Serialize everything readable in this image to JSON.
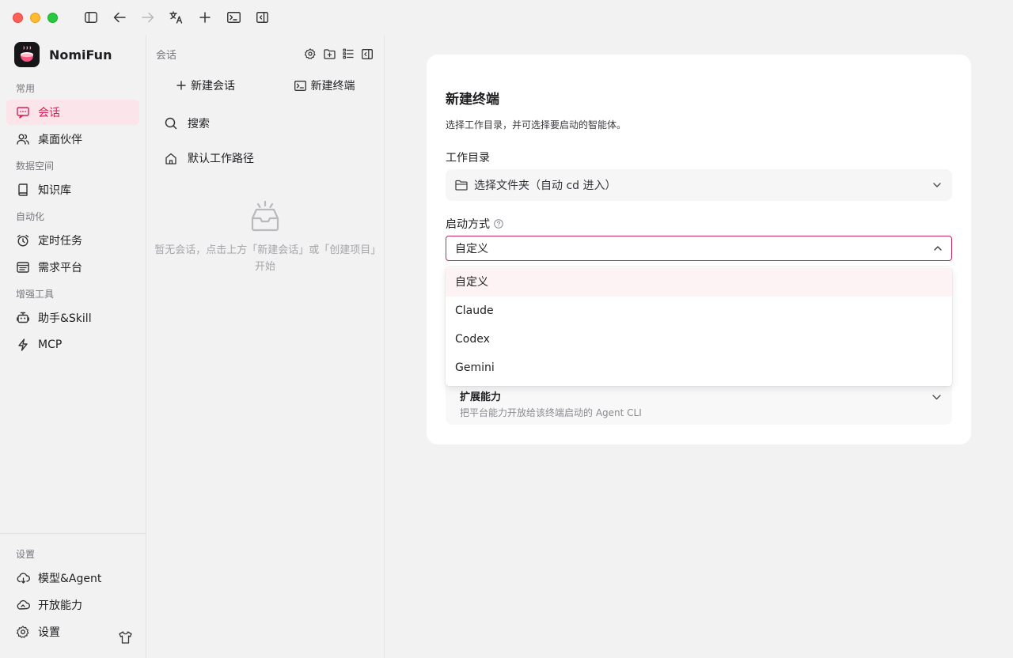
{
  "titlebar": {
    "icons": [
      "sidebar-toggle-icon",
      "arrow-left-icon",
      "arrow-right-icon",
      "translate-icon",
      "plus-icon",
      "terminal-icon",
      "panel-right-icon"
    ]
  },
  "brand": {
    "name": "NomiFun"
  },
  "sidebar": {
    "sections": {
      "common": "常用",
      "data": "数据空间",
      "automation": "自动化",
      "tools": "增强工具",
      "settings": "设置"
    },
    "items": {
      "chat": "会话",
      "partner": "桌面伙伴",
      "knowledge": "知识库",
      "scheduled": "定时任务",
      "requirements": "需求平台",
      "assistant": "助手&Skill",
      "mcp": "MCP",
      "model": "模型&Agent",
      "open": "开放能力",
      "settings": "设置"
    },
    "active_color": "#d81f55"
  },
  "conversations": {
    "title": "会话",
    "new_chat": "新建会话",
    "new_terminal": "新建终端",
    "search": "搜索",
    "default_path": "默认工作路径",
    "empty_text": "暂无会话，点击上方「新建会话」或「创建项目」开始"
  },
  "main": {
    "title": "新建终端",
    "description": "选择工作目录，并可选择要启动的智能体。",
    "workdir_label": "工作目录",
    "workdir_placeholder": "选择文件夹（自动 cd 进入）",
    "launch_label": "启动方式",
    "launch_value": "自定义",
    "options": [
      "自定义",
      "Claude",
      "Codex",
      "Gemini"
    ],
    "ext_title": "扩展能力",
    "ext_sub": "把平台能力开放给该终端启动的 Agent CLI"
  }
}
